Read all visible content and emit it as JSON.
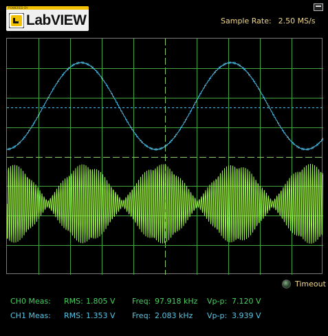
{
  "logo": {
    "powered_by": "POWERED BY",
    "brand": "LabVIEW"
  },
  "header": {
    "sample_rate_label": "Sample Rate:",
    "sample_rate_value": "2.50 MS/s"
  },
  "status": {
    "timeout_label": "Timeout"
  },
  "measurements": [
    {
      "channel": "CH0 Meas:",
      "rms_label": "RMS:",
      "rms": "1.805 V",
      "freq_label": "Freq:",
      "freq": "97.918 kHz",
      "vpp_label": "Vp-p:",
      "vpp": "7.120 V"
    },
    {
      "channel": "CH1 Meas:",
      "rms_label": "RMS:",
      "rms": "1.353 V",
      "freq_label": "Freq:",
      "freq": "2.083 kHz",
      "vpp_label": "Vp-p:",
      "vpp": "3.939 V"
    }
  ],
  "colors": {
    "grid": "#3fa63f",
    "ch0_trace": "#9cf542",
    "ch1_trace": "#4fc3ee",
    "label_text": "#f2d98a"
  }
}
